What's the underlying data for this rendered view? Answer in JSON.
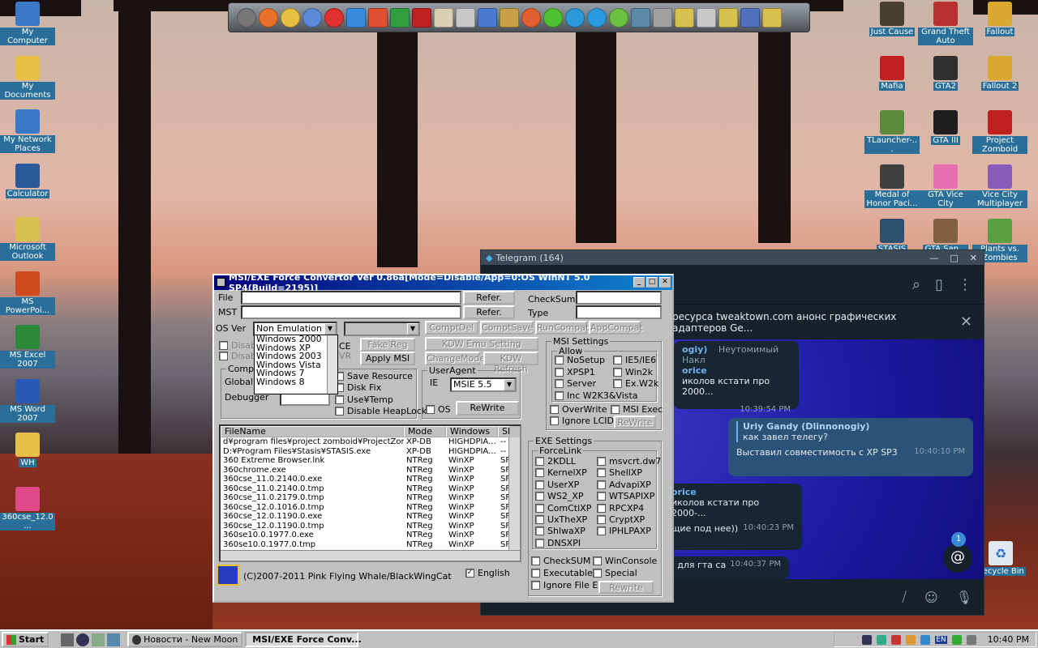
{
  "desktop": {
    "left_icons": [
      {
        "label": "My Computer",
        "icon": "computer-icon",
        "color": "#3a78c8"
      },
      {
        "label": "My Documents",
        "icon": "folder-documents-icon",
        "color": "#e8c048"
      },
      {
        "label": "My Network Places",
        "icon": "network-icon",
        "color": "#3a78c8"
      },
      {
        "label": "Calculator",
        "icon": "calculator-icon",
        "color": "#2a5a9a"
      },
      {
        "label": "Microsoft Outlook",
        "icon": "outlook-icon",
        "color": "#d8c050"
      },
      {
        "label": "MS PowerPoi...",
        "icon": "powerpoint-icon",
        "color": "#d04a20"
      },
      {
        "label": "MS Excel 2007",
        "icon": "excel-icon",
        "color": "#2a8a3a"
      },
      {
        "label": "MS Word 2007",
        "icon": "word-icon",
        "color": "#2a5ab8"
      },
      {
        "label": "WH",
        "icon": "folder-icon",
        "color": "#e8c048"
      },
      {
        "label": "360cse_12.0...",
        "icon": "browser-360-icon",
        "color": "#e04a8a"
      }
    ],
    "right_icons": [
      {
        "label": "Just Cause",
        "icon": "game-icon",
        "color": "#4a4030"
      },
      {
        "label": "Grand Theft Auto",
        "icon": "game-icon",
        "color": "#b83030"
      },
      {
        "label": "Fallout",
        "icon": "game-icon",
        "color": "#d8a830"
      },
      {
        "label": "Mafia",
        "icon": "game-icon",
        "color": "#c02020"
      },
      {
        "label": "GTA2",
        "icon": "game-icon",
        "color": "#303030"
      },
      {
        "label": "Fallout 2",
        "icon": "game-icon",
        "color": "#d8a830"
      },
      {
        "label": "TLauncher-...",
        "icon": "minecraft-icon",
        "color": "#5a8a3a"
      },
      {
        "label": "GTA III",
        "icon": "game-icon",
        "color": "#202020"
      },
      {
        "label": "Project Zomboid",
        "icon": "game-icon",
        "color": "#c02020"
      },
      {
        "label": "Medal of Honor Paci...",
        "icon": "game-icon",
        "color": "#404040"
      },
      {
        "label": "GTA Vice City",
        "icon": "game-icon",
        "color": "#e870b0"
      },
      {
        "label": "Vice City Multiplayer",
        "icon": "game-icon",
        "color": "#8a5ab8"
      },
      {
        "label": "STASIS",
        "icon": "game-icon",
        "color": "#305070"
      },
      {
        "label": "GTA San...",
        "icon": "game-icon",
        "color": "#806040"
      },
      {
        "label": "Plants vs. Zombies",
        "icon": "game-icon",
        "color": "#58a040"
      }
    ],
    "recycle_bin": "Recycle Bin"
  },
  "telegram": {
    "title": "Telegram (164)",
    "pinned": "ресурса tweaktown.com анонс графических адаптеров Ge...",
    "messages": [
      {
        "name": "ogiy)",
        "extra": "Неутомимый Накл",
        "line1": "orice",
        "line2": "иколов кстати про 2000...",
        "time": "10:39:54 PM"
      },
      {
        "name": "Uriy Gandy (Dlinnonogiy)",
        "quote": "как завел телегу?",
        "text": "Выставил совместимость с XP SP3",
        "time": "10:40:10 PM"
      },
      {
        "line1": "orice",
        "line2": "иколов кстати про 2000-...",
        "line3": "щие под нее))",
        "time": "10:40:23 PM"
      },
      {
        "text": "а для гта са",
        "time": "10:40:37 PM"
      }
    ],
    "badge": "1"
  },
  "msi": {
    "title": "MSI/EXE Force Convertor Ver 0.86a[Mode=Disable/App=0:OS WinNT 5.0 SP4(Build=2195)]",
    "file_label": "File",
    "mst_label": "MST",
    "refer": "Refer.",
    "checksum_label": "CheckSum",
    "type_label": "Type",
    "osver_label": "OS Ver",
    "osver_value": "Non Emulation",
    "os_options": [
      "Windows 2000",
      "Windows XP",
      "Windows 2003",
      "Windows Vista",
      "Windows 7",
      "Windows 8"
    ],
    "comp_buttons": [
      "ComptDel",
      "ComptSave",
      "RunCompat",
      "AppCompat"
    ],
    "kdw_emu": "KDW Emu Setting",
    "change_mode": "ChangeMode",
    "kdw_refresh": "KDW Refresh",
    "fake_reg": "Fake Reg",
    "apply_msi": "Apply MSI",
    "disab1": "Disab",
    "disab2": "Disab",
    "ce": "CE",
    "vr": "VR",
    "compat_group": "Compa",
    "global_label": "Global",
    "debugger_label": "Debugger",
    "save_resource": "Save Resource",
    "disk_fix": "Disk Fix",
    "use_temp": "Use¥Temp",
    "disable_heaplock": "Disable HeapLock",
    "useragent_group": "UserAgent",
    "ie_label": "IE",
    "ie_value": "MSIE 5.5",
    "os_check": "OS",
    "rewrite": "ReWrite",
    "msi_settings": "MSI Settings",
    "allow": "Allow",
    "allow_items": [
      "NoSetup",
      "XPSP1",
      "Server",
      "Inc W2K3&Vista"
    ],
    "allow_items_right": [
      "IE5/IE6",
      "Win2k",
      "Ex.W2k"
    ],
    "overwrite": "OverWrite",
    "msi_exec": "MSI Exec",
    "ignore_lcid": "Ignore LCID",
    "rewrite_msi": "ReWrite",
    "exe_settings": "EXE Settings",
    "forcelink": "ForceLink",
    "forcelink_left": [
      "2KDLL",
      "KernelXP",
      "UserXP",
      "WS2_XP",
      "ComCtlXP",
      "UxTheXP",
      "ShlwaXP",
      "DNSXPI"
    ],
    "forcelink_right": [
      "msvcrt.dw7",
      "ShellXP",
      "AdvapiXP",
      "WTSAPIXP",
      "RPCXP4",
      "CryptXP",
      "IPHLPAXP"
    ],
    "checksum_chk": "CheckSUM",
    "winconsole": "WinConsole",
    "executable": "Executable",
    "special": "Special",
    "ignore_file_ext": "Ignore File Ext",
    "rewrite_exe": "Rewrite",
    "table_headers": [
      "FileName",
      "Mode",
      "Windows",
      "SF"
    ],
    "rows": [
      [
        "d¥program files¥project zomboid¥ProjectZomb...",
        "XP-DB",
        "HIGHDPIA...",
        "--"
      ],
      [
        "D:¥Program Files¥Stasis¥STASIS.exe",
        "XP-DB",
        "HIGHDPIA...",
        "--"
      ],
      [
        "360 Extreme Browser.lnk",
        "NTReg",
        "WinXP",
        "SF"
      ],
      [
        "360chrome.exe",
        "NTReg",
        "WinXP",
        "SF"
      ],
      [
        "360cse_11.0.2140.0.exe",
        "NTReg",
        "WinXP",
        "SF"
      ],
      [
        "360cse_11.0.2140.0.tmp",
        "NTReg",
        "WinXP",
        "SF"
      ],
      [
        "360cse_11.0.2179.0.tmp",
        "NTReg",
        "WinXP",
        "SF"
      ],
      [
        "360cse_12.0.1016.0.tmp",
        "NTReg",
        "WinXP",
        "SF"
      ],
      [
        "360cse_12.0.1190.0.exe",
        "NTReg",
        "WinXP",
        "SF"
      ],
      [
        "360cse_12.0.1190.0.tmp",
        "NTReg",
        "WinXP",
        "SF"
      ],
      [
        "360se10.0.1977.0.exe",
        "NTReg",
        "WinXP",
        "SF"
      ],
      [
        "360se10.0.1977.0.tmp",
        "NTReg",
        "WinXP",
        "SF"
      ]
    ],
    "copyright": "(C)2007-2011 Pink Flying Whale/BlackWingCat",
    "english": "English"
  },
  "taskbar": {
    "start": "Start",
    "tasks": [
      "Новости - New Moon",
      "MSI/EXE Force Conv..."
    ],
    "lang": "EN",
    "clock": "10:40 PM"
  },
  "colors": {
    "title_start": "#00007c",
    "title_end": "#1084d0",
    "face": "#c0c0c0",
    "tg_bg": "#17212b"
  }
}
